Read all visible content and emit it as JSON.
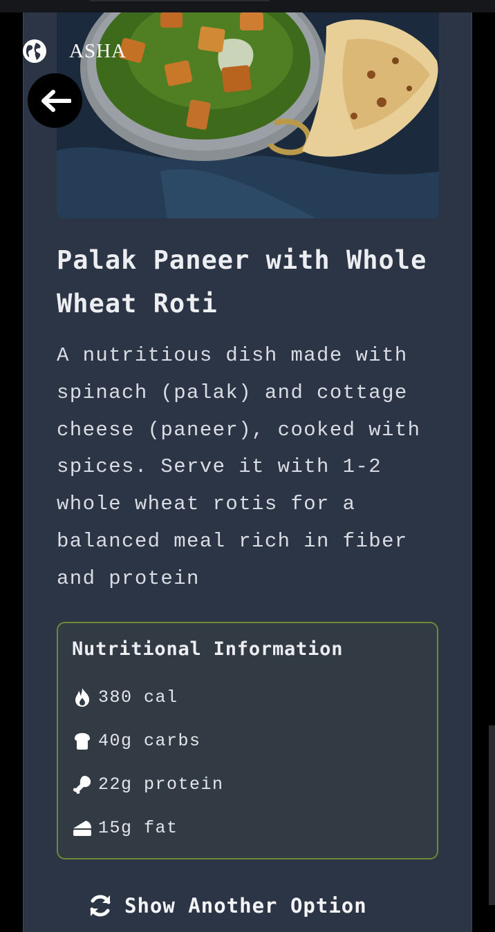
{
  "header": {
    "brand_name": "ASHA",
    "brand_icon": "globe-icon",
    "back_icon": "arrow-left-icon"
  },
  "recipe": {
    "title": "Palak Paneer with Whole Wheat Roti",
    "description": "A nutritious dish made with spinach (palak) and cottage cheese (paneer), cooked with spices. Serve it with 1-2 whole wheat rotis for a balanced meal rich in fiber and protein"
  },
  "nutrition": {
    "title": "Nutritional Information",
    "items": [
      {
        "icon": "fire-icon",
        "label": "380 cal"
      },
      {
        "icon": "bread-icon",
        "label": "40g carbs"
      },
      {
        "icon": "drumstick-icon",
        "label": "22g protein"
      },
      {
        "icon": "cheese-icon",
        "label": "15g fat"
      }
    ]
  },
  "actions": {
    "show_another_label": "Show Another Option",
    "show_another_icon": "refresh-icon"
  },
  "colors": {
    "background": "#2c3545",
    "nutrition_border": "#6f8a33",
    "nutrition_bg": "#323b44"
  }
}
